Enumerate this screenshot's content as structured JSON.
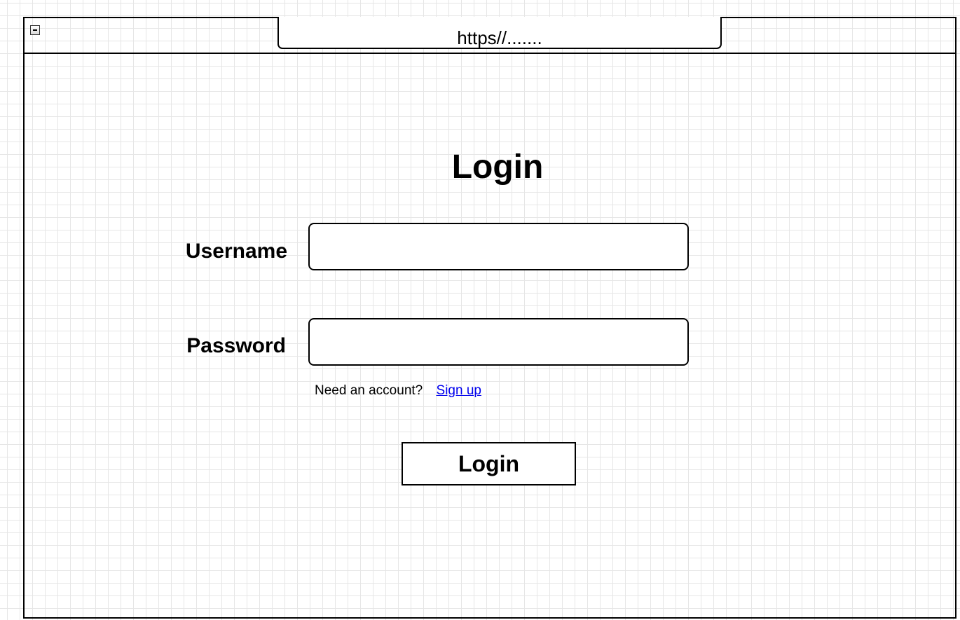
{
  "browser": {
    "url": "https//......."
  },
  "login_form": {
    "title": "Login",
    "username_label": "Username",
    "password_label": "Password",
    "username_value": "",
    "password_value": "",
    "signup_prompt": "Need an account?",
    "signup_link": "Sign up",
    "submit_label": "Login"
  },
  "icons": {
    "window_control": "minimize-icon"
  },
  "colors": {
    "link": "#0000ee",
    "grid": "#e6e6e6",
    "border": "#000000"
  }
}
